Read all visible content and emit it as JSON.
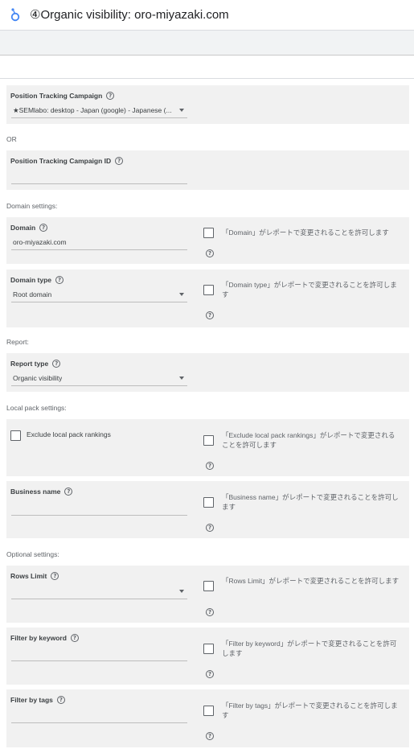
{
  "header": {
    "title": "④Organic visibility: oro-miyazaki.com",
    "logo_icon": "looker-studio-logo-icon"
  },
  "fields": {
    "campaign": {
      "label": "Position Tracking Campaign",
      "value": "★SEMlabo: desktop - Japan (google) - Japanese (..."
    },
    "or_text": "OR",
    "campaign_id": {
      "label": "Position Tracking Campaign ID",
      "value": ""
    }
  },
  "sections": {
    "domain_settings": "Domain settings:",
    "report": "Report:",
    "local_pack": "Local pack settings:",
    "optional": "Optional settings:"
  },
  "domain": {
    "label": "Domain",
    "value": "oro-miyazaki.com",
    "allow_label": "「Domain」がレポートで変更されることを許可します"
  },
  "domain_type": {
    "label": "Domain type",
    "value": "Root domain",
    "allow_label": "「Domain type」がレポートで変更されることを許可します"
  },
  "report_type": {
    "label": "Report type",
    "value": "Organic visibility"
  },
  "exclude_local": {
    "label": "Exclude local pack rankings",
    "allow_label": "「Exclude local pack rankings」がレポートで変更されることを許可します"
  },
  "business_name": {
    "label": "Business name",
    "value": "",
    "allow_label": "「Business name」がレポートで変更されることを許可します"
  },
  "rows_limit": {
    "label": "Rows Limit",
    "value": "",
    "allow_label": "「Rows Limit」がレポートで変更されることを許可します"
  },
  "filter_keyword": {
    "label": "Filter by keyword",
    "value": "",
    "allow_label": "「Filter by keyword」がレポートで変更されることを許可します"
  },
  "filter_tags": {
    "label": "Filter by tags",
    "value": "",
    "allow_label": "「Filter by tags」がレポートで変更されることを許可します"
  },
  "icons": {
    "help": "help-circle-icon",
    "caret": "dropdown-caret-icon"
  },
  "help_glyph": "?"
}
